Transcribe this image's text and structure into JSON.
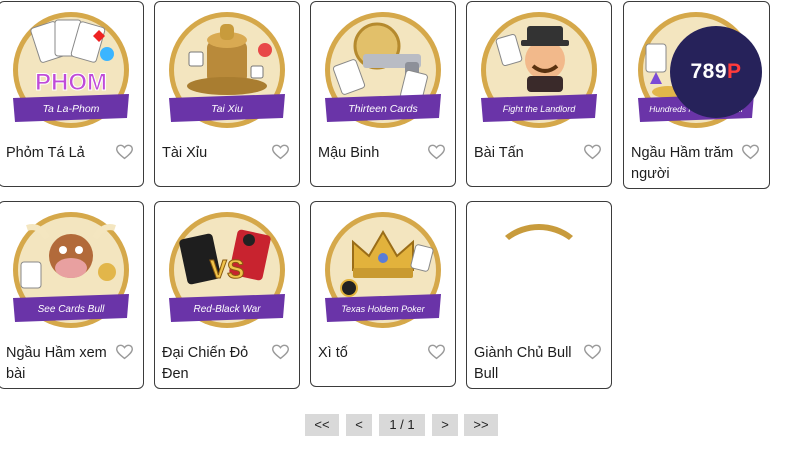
{
  "games": [
    {
      "title": "Phỏm Tá Lả",
      "ribbon": "Ta La-Phom",
      "art_text": "PHOM",
      "theme": "#6a34a8"
    },
    {
      "title": "Tài Xỉu",
      "ribbon": "Tai Xiu",
      "theme": "#6a34a8"
    },
    {
      "title": "Mậu Binh",
      "ribbon": "Thirteen Cards",
      "theme": "#6a34a8"
    },
    {
      "title": "Bài Tấn",
      "ribbon": "Fight the Landlord",
      "theme": "#6a34a8"
    },
    {
      "title": "Ngầu Hầm trăm người",
      "ribbon": "Hundreds People Of Bull",
      "theme": "#6a34a8"
    },
    {
      "title": "Ngầu Hầm xem bài",
      "ribbon": "See Cards Bull",
      "theme": "#6a34a8"
    },
    {
      "title": "Đại Chiến Đỏ Đen",
      "ribbon": "Red-Black War",
      "art_text": "VS",
      "theme": "#6a34a8"
    },
    {
      "title": "Xì tố",
      "ribbon": "Texas Holdem Poker",
      "theme": "#6a34a8"
    },
    {
      "title": "Giành Chủ Bull Bull",
      "ribbon": "",
      "theme": "#6a34a8"
    }
  ],
  "overlay_logo": {
    "text_main": "789",
    "text_accent": "P"
  },
  "pagination": {
    "first_label": "<<",
    "prev_label": "<",
    "page_label": "1 / 1",
    "next_label": ">",
    "last_label": ">>"
  },
  "icons": {
    "favorite": "heart-outline-icon"
  },
  "colors": {
    "card_border": "#3b3b3b",
    "heart": "#9a9a9a",
    "pager_bg": "#d9d9d9",
    "ribbon": "#6a34a8",
    "gold": "#c89b3c"
  }
}
